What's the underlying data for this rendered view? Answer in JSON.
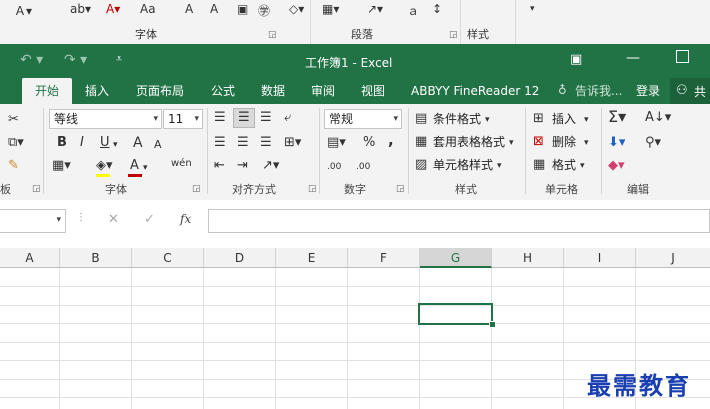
{
  "top_strip": {
    "groups": [
      "字体",
      "段落",
      "样式"
    ],
    "text_fragments": [
      "Aa"
    ]
  },
  "titlebar": {
    "title": "工作簿1 - Excel",
    "qat_icons": [
      "undo-icon",
      "redo-icon",
      "customize-qat-icon"
    ],
    "window_icons": [
      "ribbon-display-icon",
      "minimize-icon",
      "maximize-icon"
    ]
  },
  "tabs": {
    "items": [
      "开始",
      "插入",
      "页面布局",
      "公式",
      "数据",
      "审阅",
      "视图",
      "ABBYY FineReader 12"
    ],
    "active": "开始",
    "tell_me": "告诉我...",
    "signin": "登录",
    "share": "共"
  },
  "ribbon": {
    "groups": {
      "clipboard": "板",
      "font": "字体",
      "alignment": "对齐方式",
      "number": "数字",
      "styles": "样式",
      "cells": "单元格",
      "editing": "编辑"
    },
    "font_name": "等线",
    "font_size": "11",
    "font_buttons": {
      "bold": "B",
      "italic": "I",
      "underline": "U",
      "font_color": "A",
      "grow": "A",
      "shrink": "A",
      "phonetic": "wén"
    },
    "number_format": "常规",
    "percent": "%",
    "comma": ",",
    "dec_inc": ".00",
    "dec_dec": ".00",
    "styles_buttons": [
      "条件格式",
      "套用表格格式",
      "单元格样式"
    ],
    "cells_buttons": [
      "插入",
      "删除",
      "格式"
    ],
    "editing_icons": [
      "autosum-icon",
      "sort-filter-icon",
      "fill-icon",
      "find-icon",
      "clear-icon"
    ]
  },
  "formula_bar": {
    "name_box": "",
    "fx": "fx",
    "content": ""
  },
  "grid": {
    "columns": [
      "A",
      "B",
      "C",
      "D",
      "E",
      "F",
      "G",
      "H",
      "I",
      "J"
    ],
    "selected_column": "G"
  },
  "watermark": "最需教育",
  "colors": {
    "accent": "#217346",
    "selection": "#217346",
    "font_color_bar": "#c00000",
    "highlight_bar": "#ffff00"
  }
}
